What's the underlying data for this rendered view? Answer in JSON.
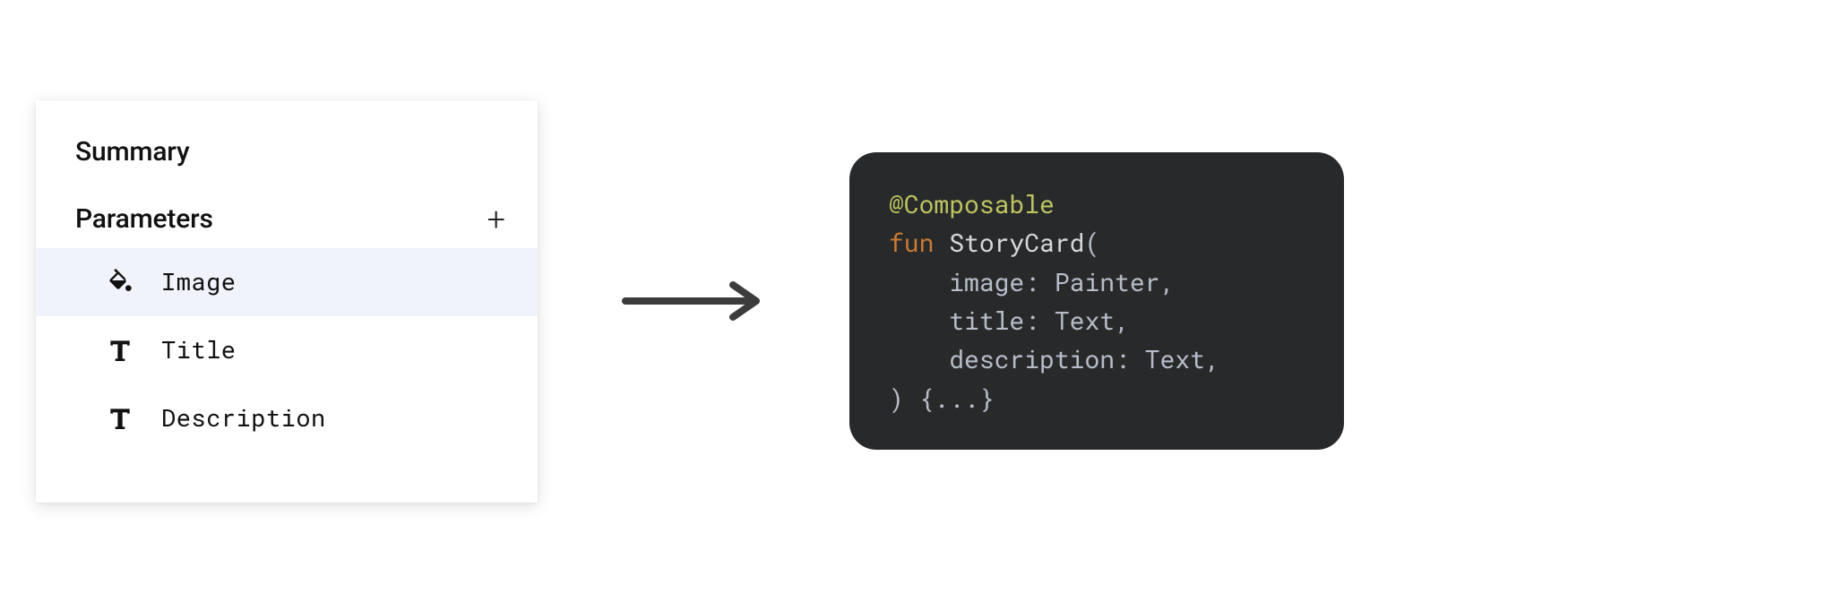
{
  "panel": {
    "summary_heading": "Summary",
    "parameters_heading": "Parameters",
    "add_glyph": "+",
    "items": [
      {
        "icon": "format-color-fill",
        "label": "Image",
        "selected": true
      },
      {
        "icon": "text-t",
        "label": "Title",
        "selected": false
      },
      {
        "icon": "text-t",
        "label": "Description",
        "selected": false
      }
    ]
  },
  "code": {
    "annotation": "@Composable",
    "keyword_fun": "fun",
    "func_name": "StoryCard",
    "open_paren": "(",
    "params": [
      {
        "name": "image",
        "type": "Painter"
      },
      {
        "name": "title",
        "type": "Text"
      },
      {
        "name": "description",
        "type": "Text"
      }
    ],
    "close_body": ") {...}"
  }
}
